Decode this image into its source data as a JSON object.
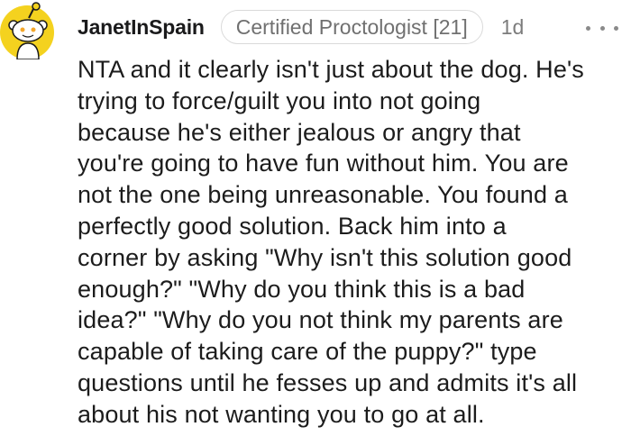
{
  "comment": {
    "username": "JanetInSpain",
    "flair": "Certified Proctologist [21]",
    "age": "1d",
    "avatar_icon": "snoo-avatar-icon",
    "more_icon": "more-options-icon",
    "accent_color": "#f1c40f",
    "body_lines": [
      "NTA and it clearly isn't just about the dog. He's",
      "trying to force/guilt you into not going",
      "because he's either jealous or angry that",
      "you're going to have fun without him. You are",
      "not the one being unreasonable. You found a",
      "perfectly good solution. Back him into a",
      "corner by asking \"Why isn't this solution good",
      "enough?\" \"Why do you think this is a bad",
      "idea?\" \"Why do you not think my parents are",
      "capable of taking care of the puppy?\" type",
      "questions until he fesses up and admits it's all",
      "about his not wanting you to go at all."
    ]
  }
}
